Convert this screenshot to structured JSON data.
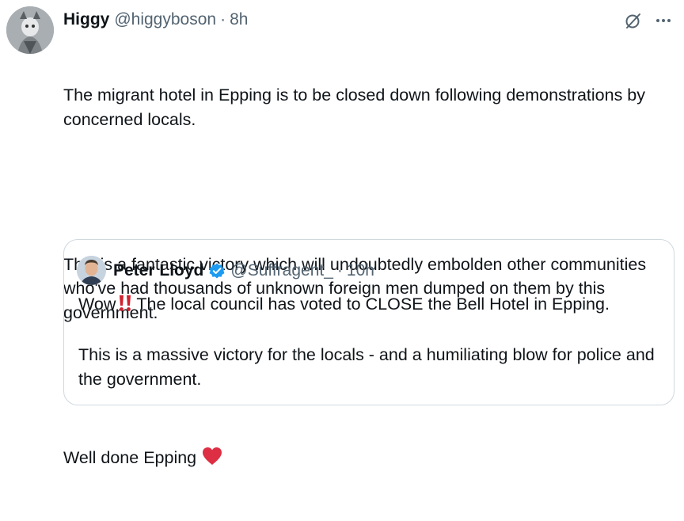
{
  "tweet": {
    "author_name": "Higgy",
    "author_handle": "@higgyboson",
    "separator": "·",
    "time": "8h",
    "paragraphs": [
      "The migrant hotel in Epping is to be closed down following demonstrations by concerned locals.",
      "This is a fantastic victory which will undoubtedly embolden other communities who've had thousands of unknown foreign men dumped on them by this government.",
      "Well done Epping"
    ],
    "emoji_after_last": "heart-icon"
  },
  "quoted_tweet": {
    "author_name": "Peter Lloyd",
    "author_handle": "@Suffragent_",
    "separator": "·",
    "time": "10h",
    "line1_prefix": "Wow",
    "line1_rest": "The local council has voted to CLOSE the Bell Hotel in Epping.",
    "paragraph2": "This is a massive victory for the locals - and a humiliating blow for police and the government."
  },
  "icons": {
    "grok": "slashed-circle-icon",
    "more": "more-dots-icon",
    "verified": "verified-badge-icon",
    "exclamation": "double-exclamation-icon"
  },
  "colors": {
    "text": "#0f1419",
    "secondary": "#536471",
    "border": "#cfd9de",
    "verified": "#1d9bf0",
    "heart": "#dd2e44"
  }
}
